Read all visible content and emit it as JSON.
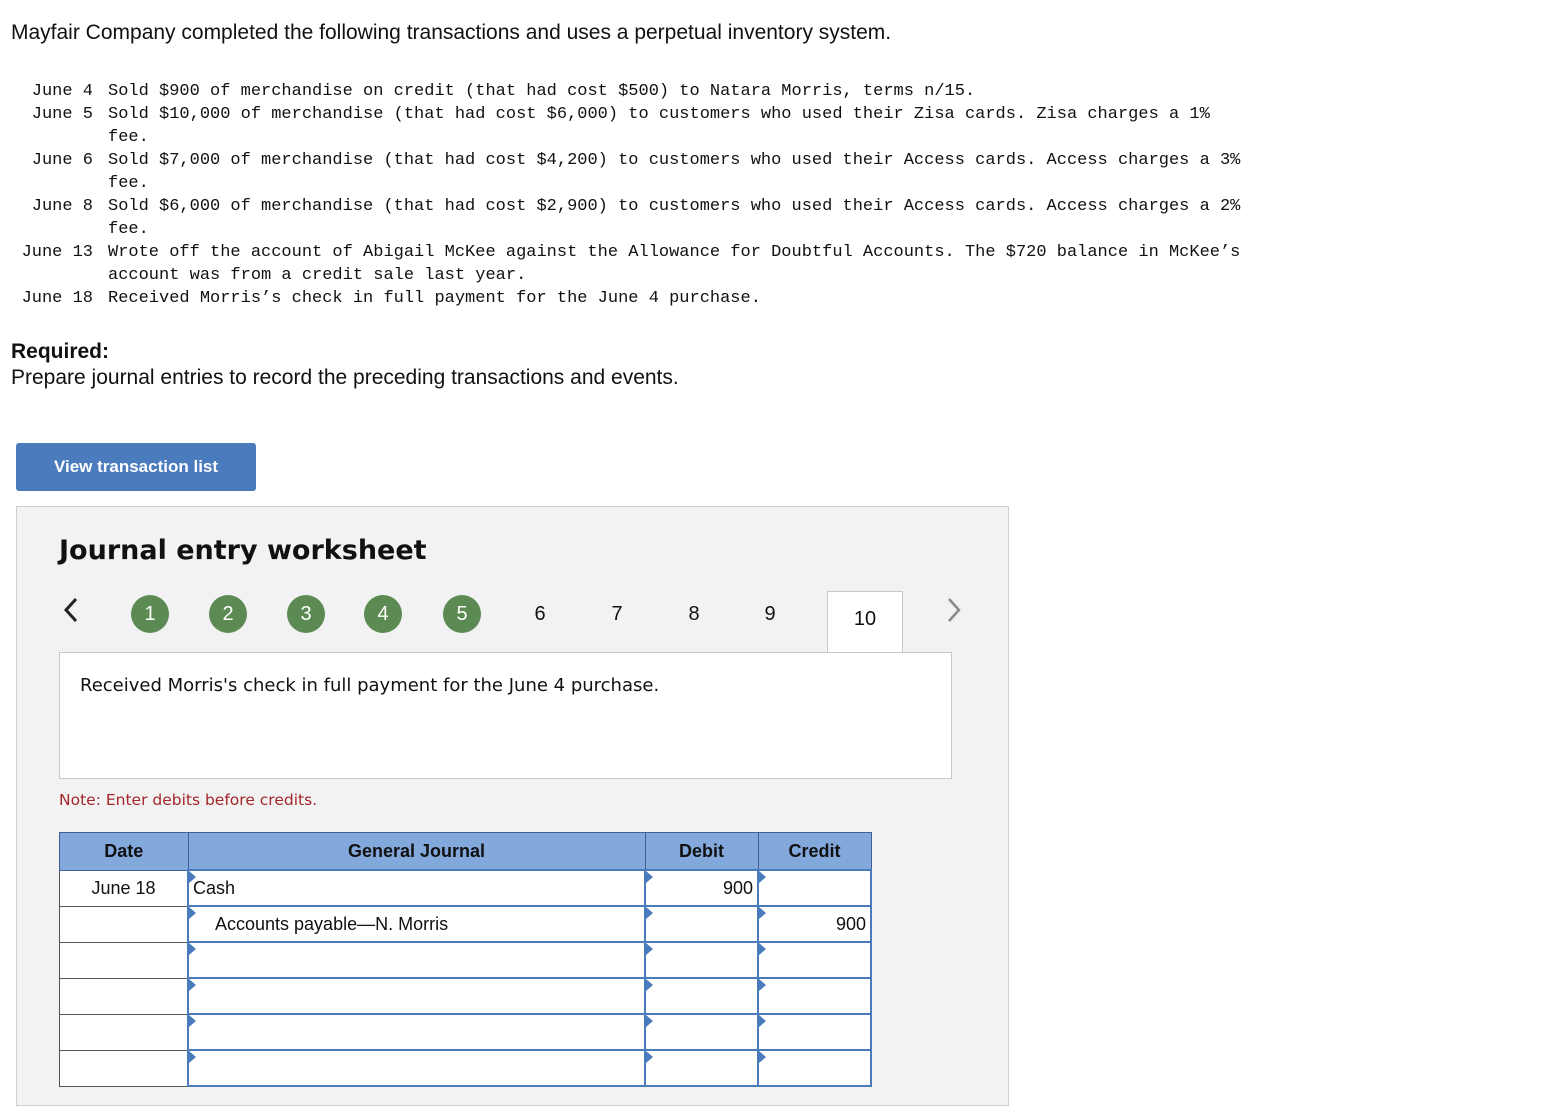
{
  "intro": "Mayfair Company completed the following transactions and uses a perpetual inventory system.",
  "transactions": [
    {
      "date": "June 4",
      "lines": [
        "Sold $900 of merchandise on credit (that had cost $500) to Natara Morris, terms n/15."
      ]
    },
    {
      "date": "June 5",
      "lines": [
        "Sold $10,000 of merchandise (that had cost $6,000) to customers who used their Zisa cards. Zisa charges a 1%",
        "fee."
      ]
    },
    {
      "date": "June 6",
      "lines": [
        "Sold $7,000 of merchandise (that had cost $4,200) to customers who used their Access cards. Access charges a 3%",
        "fee."
      ]
    },
    {
      "date": "June 8",
      "lines": [
        "Sold $6,000 of merchandise (that had cost $2,900) to customers who used their Access cards. Access charges a 2%",
        "fee."
      ]
    },
    {
      "date": "June 13",
      "lines": [
        "Wrote off the account of Abigail McKee against the Allowance for Doubtful Accounts. The $720 balance in McKee’s",
        "account was from a credit sale last year."
      ]
    },
    {
      "date": "June 18",
      "lines": [
        "Received Morris’s check in full payment for the June 4 purchase."
      ]
    }
  ],
  "required": {
    "heading": "Required:",
    "text": "Prepare journal entries to record the preceding transactions and events."
  },
  "view_button_label": "View transaction list",
  "worksheet": {
    "title": "Journal entry worksheet",
    "steps": [
      "1",
      "2",
      "3",
      "4",
      "5",
      "6",
      "7",
      "8",
      "9",
      "10"
    ],
    "completed_steps": 5,
    "active_step": "10",
    "description": "Received Morris's check in full payment for the June 4 purchase.",
    "note": "Note: Enter debits before credits.",
    "table": {
      "headers": {
        "date": "Date",
        "journal": "General Journal",
        "debit": "Debit",
        "credit": "Credit"
      },
      "rows": [
        {
          "date": "June 18",
          "account": "Cash",
          "indent": false,
          "debit": "900",
          "credit": ""
        },
        {
          "date": "",
          "account": "Accounts payable—N. Morris",
          "indent": true,
          "debit": "",
          "credit": "900"
        },
        {
          "date": "",
          "account": "",
          "indent": false,
          "debit": "",
          "credit": ""
        },
        {
          "date": "",
          "account": "",
          "indent": false,
          "debit": "",
          "credit": ""
        },
        {
          "date": "",
          "account": "",
          "indent": false,
          "debit": "",
          "credit": ""
        },
        {
          "date": "",
          "account": "",
          "indent": false,
          "debit": "",
          "credit": ""
        }
      ]
    }
  },
  "icons": {
    "prev": "chevron-left-icon",
    "next": "chevron-right-icon"
  },
  "colors": {
    "button": "#4a7bbd",
    "step_done": "#5b8a52",
    "header": "#83a8dc",
    "note": "#a3262a"
  }
}
